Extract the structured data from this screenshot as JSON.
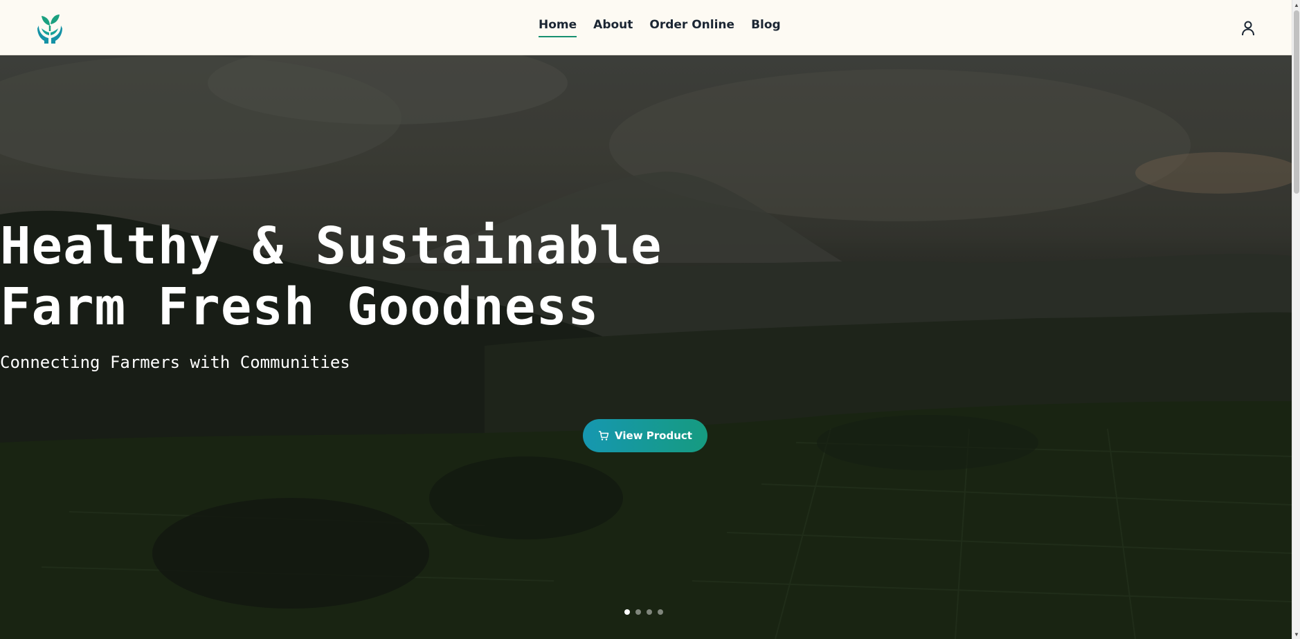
{
  "header": {
    "logo_icon": "sprout-in-hands-icon",
    "nav": [
      {
        "label": "Home",
        "active": true
      },
      {
        "label": "About",
        "active": false
      },
      {
        "label": "Order Online",
        "active": false
      },
      {
        "label": "Blog",
        "active": false
      }
    ],
    "user_icon": "user-icon"
  },
  "hero": {
    "title_line1": "Healthy & Sustainable",
    "title_line2": "Farm Fresh Goodness",
    "subtitle": "Connecting Farmers with Communities",
    "cta_label": "View Product",
    "cta_icon": "cart-icon",
    "slides_count": 4,
    "active_slide": 1
  },
  "colors": {
    "header_bg": "#fdfaf3",
    "accent": "#16906f",
    "cta_gradient_start": "#1697b0",
    "cta_gradient_end": "#169b80",
    "logo": "#1a9b8a"
  }
}
